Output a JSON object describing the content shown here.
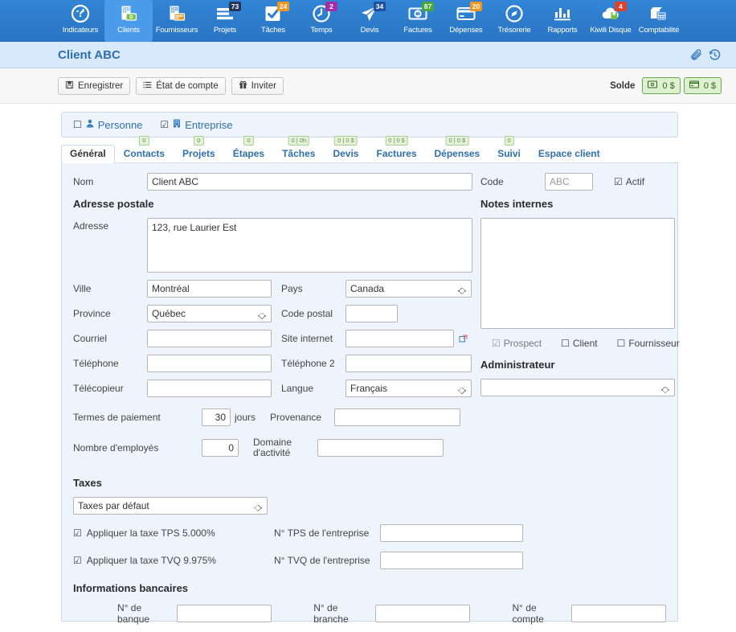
{
  "nav": {
    "items": [
      {
        "label": "Indicateurs",
        "icon": "gauge-icon",
        "badge": null,
        "active": false
      },
      {
        "label": "Clients",
        "icon": "building-money-icon",
        "badge": null,
        "active": true
      },
      {
        "label": "Fournisseurs",
        "icon": "building-card-icon",
        "badge": null,
        "active": false
      },
      {
        "label": "Projets",
        "icon": "list-lines-icon",
        "badge": "73",
        "badge_color": "#23375c",
        "active": false
      },
      {
        "label": "Tâches",
        "icon": "checkbox-check-icon",
        "badge": "24",
        "badge_color": "#f0951e",
        "active": false
      },
      {
        "label": "Temps",
        "icon": "clock-icon",
        "badge": "2",
        "badge_color": "#a32fa8",
        "active": false
      },
      {
        "label": "Devis",
        "icon": "paper-plane-icon",
        "badge": "34",
        "badge_color": "#1f4e9c",
        "active": false
      },
      {
        "label": "Factures",
        "icon": "banknote-icon",
        "badge": "87",
        "badge_color": "#46a83c",
        "active": false
      },
      {
        "label": "Dépenses",
        "icon": "credit-card-icon",
        "badge": "20",
        "badge_color": "#f0951e",
        "active": false
      },
      {
        "label": "Trésorerie",
        "icon": "compass-icon",
        "badge": null,
        "active": false
      },
      {
        "label": "Rapports",
        "icon": "bar-chart-icon",
        "badge": null,
        "active": false
      },
      {
        "label": "Kiwili Disque",
        "icon": "cloud-disk-icon",
        "badge": "4",
        "badge_color": "#e0402c",
        "active": false
      },
      {
        "label": "Comptabilité",
        "icon": "ledger-icon",
        "badge": null,
        "active": false
      }
    ]
  },
  "header": {
    "title": "Client ABC",
    "attach_icon": "paperclip-icon",
    "history_icon": "history-icon"
  },
  "toolbar": {
    "save_label": "Enregistrer",
    "statement_label": "État de compte",
    "invite_label": "Inviter",
    "solde_label": "Solde",
    "solde_cash": "0 $",
    "solde_credit": "0 $"
  },
  "entity_type": {
    "personne_label": "Personne",
    "personne_checked": false,
    "entreprise_label": "Entreprise",
    "entreprise_checked": true
  },
  "tabs": [
    {
      "label": "Général",
      "badge": null,
      "active": true
    },
    {
      "label": "Contacts",
      "badge": "0",
      "active": false
    },
    {
      "label": "Projets",
      "badge": "0",
      "active": false
    },
    {
      "label": "Étapes",
      "badge": "0",
      "active": false
    },
    {
      "label": "Tâches",
      "badge": "0 | 0h",
      "active": false
    },
    {
      "label": "Devis",
      "badge": "0 | 0 $",
      "active": false
    },
    {
      "label": "Factures",
      "badge": "0 | 0 $",
      "active": false
    },
    {
      "label": "Dépenses",
      "badge": "0 | 0 $",
      "active": false
    },
    {
      "label": "Suivi",
      "badge": "0",
      "active": false
    },
    {
      "label": "Espace client",
      "badge": null,
      "active": false
    }
  ],
  "form": {
    "nom_label": "Nom",
    "nom_value": "Client ABC",
    "code_label": "Code",
    "code_placeholder": "ABC",
    "code_value": "",
    "actif_label": "Actif",
    "actif_checked": true,
    "adresse_postale_heading": "Adresse postale",
    "adresse_label": "Adresse",
    "adresse_value": "123, rue Laurier Est",
    "ville_label": "Ville",
    "ville_value": "Montréal",
    "pays_label": "Pays",
    "pays_value": "Canada",
    "province_label": "Province",
    "province_value": "Québec",
    "code_postal_label": "Code postal",
    "code_postal_value": "",
    "courriel_label": "Courriel",
    "courriel_value": "",
    "site_internet_label": "Site internet",
    "site_internet_value": "",
    "site_link_icon": "external-link-icon",
    "telephone_label": "Téléphone",
    "telephone_value": "",
    "telephone2_label": "Téléphone 2",
    "telephone2_value": "",
    "telecopieur_label": "Télécopieur",
    "telecopieur_value": "",
    "langue_label": "Langue",
    "langue_value": "Français",
    "termes_label": "Termes de paiement",
    "termes_value": "30",
    "termes_unit": "jours",
    "provenance_label": "Provenance",
    "provenance_value": "",
    "employes_label": "Nombre d'employés",
    "employes_value": "0",
    "domaine_label": "Domaine d'activité",
    "domaine_value": "",
    "notes_heading": "Notes internes",
    "notes_value": "",
    "prospect_label": "Prospect",
    "prospect_checked": true,
    "client_label": "Client",
    "client_checked": false,
    "fournisseur_label": "Fournisseur",
    "fournisseur_checked": false,
    "administrateur_heading": "Administrateur",
    "administrateur_value": "",
    "taxes_heading": "Taxes",
    "taxes_select_value": "Taxes par défaut",
    "tps_label": "Appliquer la taxe TPS 5.000%",
    "tps_checked": true,
    "tps_num_label": "N° TPS de l'entreprise",
    "tps_num_value": "",
    "tvq_label": "Appliquer la taxe TVQ 9.975%",
    "tvq_checked": true,
    "tvq_num_label": "N° TVQ de l'entreprise",
    "tvq_num_value": "",
    "bancaires_heading": "Informations bancaires",
    "banque_label": "N° de banque",
    "banque_value": "",
    "branche_label": "N° de branche",
    "branche_value": "",
    "compte_label": "N° de compte",
    "compte_value": ""
  },
  "colors": {
    "nav_blue": "#2d7dd2",
    "nav_active": "#4a9bea",
    "title_bg": "#d7e9fb",
    "link_blue": "#2f6fab",
    "panel_bg": "#eef4fc",
    "panel_border": "#c9d9ec",
    "badge_green_bg": "#e4f2d9",
    "badge_green_border": "#a9cf8e",
    "solde_green_bg": "#dff0d1"
  }
}
